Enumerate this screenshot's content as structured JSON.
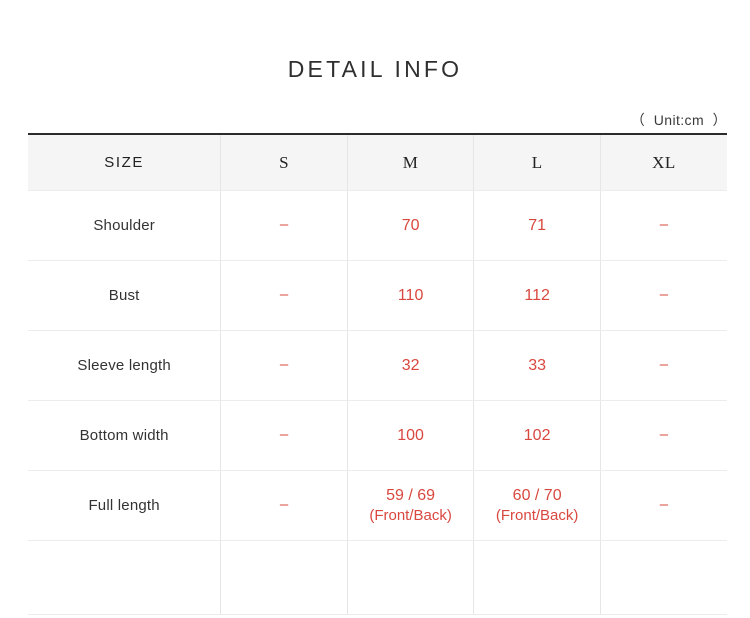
{
  "title": "DETAIL INFO",
  "unit_note": "（  Unit:cm  ）",
  "table": {
    "columns": [
      "SIZE",
      "S",
      "M",
      "L",
      "XL"
    ],
    "rows": [
      {
        "label": "Shoulder",
        "values": [
          {
            "main": "–",
            "sub": ""
          },
          {
            "main": "70",
            "sub": ""
          },
          {
            "main": "71",
            "sub": ""
          },
          {
            "main": "–",
            "sub": ""
          }
        ]
      },
      {
        "label": "Bust",
        "values": [
          {
            "main": "–",
            "sub": ""
          },
          {
            "main": "110",
            "sub": ""
          },
          {
            "main": "112",
            "sub": ""
          },
          {
            "main": "–",
            "sub": ""
          }
        ]
      },
      {
        "label": "Sleeve length",
        "values": [
          {
            "main": "–",
            "sub": ""
          },
          {
            "main": "32",
            "sub": ""
          },
          {
            "main": "33",
            "sub": ""
          },
          {
            "main": "–",
            "sub": ""
          }
        ]
      },
      {
        "label": "Bottom width",
        "values": [
          {
            "main": "–",
            "sub": ""
          },
          {
            "main": "100",
            "sub": ""
          },
          {
            "main": "102",
            "sub": ""
          },
          {
            "main": "–",
            "sub": ""
          }
        ]
      },
      {
        "label": "Full length",
        "values": [
          {
            "main": "–",
            "sub": ""
          },
          {
            "main": "59 / 69",
            "sub": "(Front/Back)"
          },
          {
            "main": "60 / 70",
            "sub": "(Front/Back)"
          },
          {
            "main": "–",
            "sub": ""
          }
        ]
      },
      {
        "label": "",
        "values": [
          {
            "main": "",
            "sub": ""
          },
          {
            "main": "",
            "sub": ""
          },
          {
            "main": "",
            "sub": ""
          },
          {
            "main": "",
            "sub": ""
          }
        ]
      }
    ]
  },
  "colors": {
    "value_red": "#d9483f",
    "header_bg": "#f5f5f5",
    "top_border": "#2b2b2b",
    "grid_line": "#ececec"
  }
}
